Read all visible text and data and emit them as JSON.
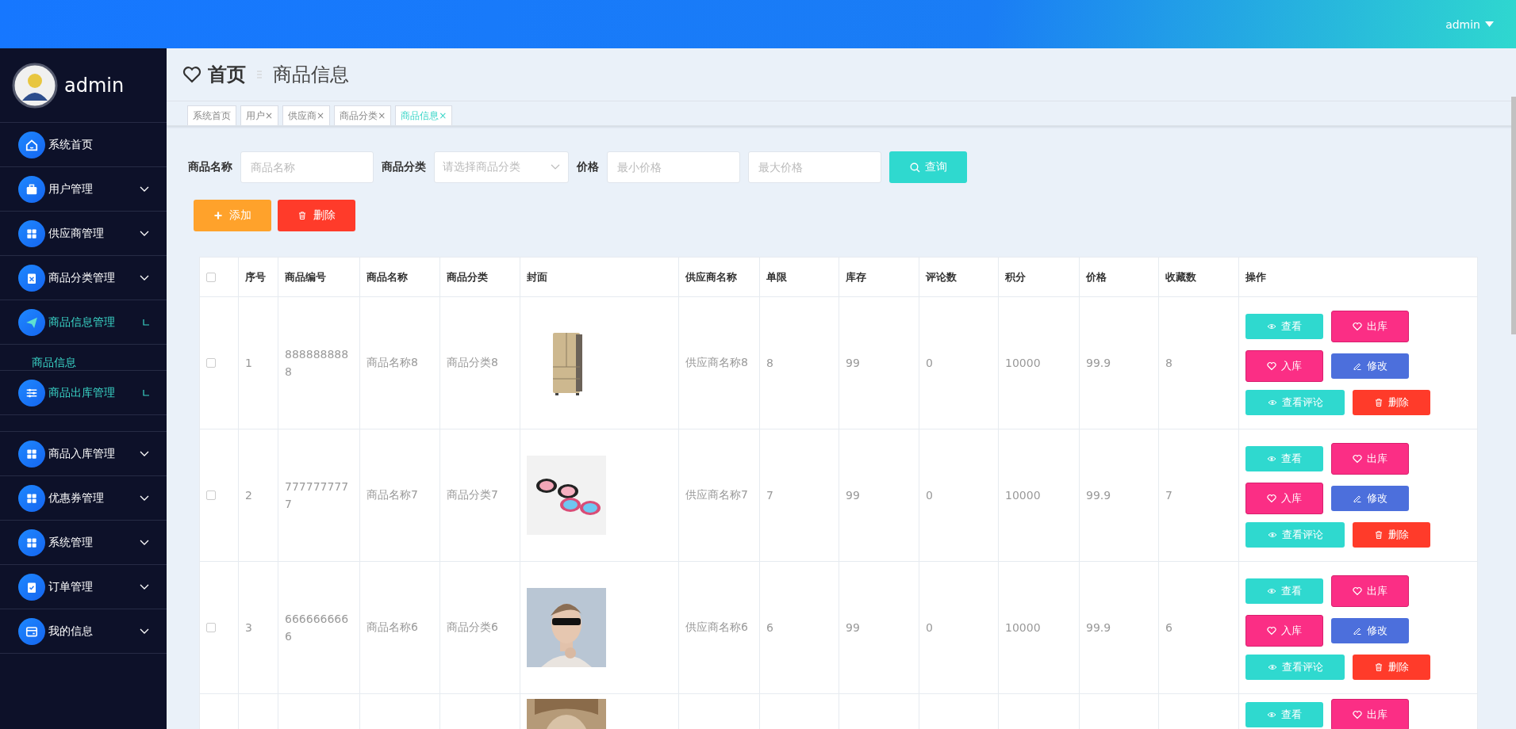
{
  "topbar": {
    "user": "admin"
  },
  "sidebar": {
    "user": "admin",
    "items": [
      {
        "label": "系统首页",
        "kind": "link"
      },
      {
        "label": "用户管理",
        "kind": "menu",
        "expanded": false
      },
      {
        "label": "供应商管理",
        "kind": "menu",
        "expanded": false
      },
      {
        "label": "商品分类管理",
        "kind": "menu",
        "expanded": false
      },
      {
        "label": "商品信息管理",
        "kind": "menu",
        "expanded": true,
        "children": [
          {
            "label": "商品信息",
            "selected": true
          }
        ]
      },
      {
        "label": "商品出库管理",
        "kind": "menu",
        "expanded": true
      },
      {
        "label": "商品入库管理",
        "kind": "menu",
        "expanded": false
      },
      {
        "label": "优惠券管理",
        "kind": "menu",
        "expanded": false
      },
      {
        "label": "系统管理",
        "kind": "menu",
        "expanded": false
      },
      {
        "label": "订单管理",
        "kind": "menu",
        "expanded": false
      },
      {
        "label": "我的信息",
        "kind": "menu",
        "expanded": false
      }
    ]
  },
  "heading": {
    "home": "首页",
    "current": "商品信息"
  },
  "tags": [
    {
      "label": "系统首页",
      "selected": false
    },
    {
      "label": "用户",
      "close": "×",
      "selected": false
    },
    {
      "label": "供应商",
      "close": "×",
      "selected": false
    },
    {
      "label": "商品分类",
      "close": "×",
      "selected": false
    },
    {
      "label": "商品信息",
      "close": "×",
      "selected": true
    }
  ],
  "search": {
    "fields": [
      {
        "label": "商品名称",
        "placeholder": "商品名称",
        "kind": "input"
      },
      {
        "label": "商品分类",
        "placeholder": "请选择商品分类",
        "kind": "select"
      },
      {
        "label": "价格",
        "placeholder": "最小价格",
        "kind": "input"
      },
      {
        "placeholder": "最大价格",
        "kind": "input"
      }
    ],
    "button": "查询"
  },
  "toolbar": [
    {
      "label": "添加",
      "kind": "add"
    },
    {
      "label": "删除",
      "kind": "delete"
    }
  ],
  "table": {
    "select_all": false,
    "columns": [
      "序号",
      "商品编号",
      "商品名称",
      "商品分类",
      "封面",
      "供应商名称",
      "单限",
      "库存",
      "评论数",
      "积分",
      "价格",
      "收藏数",
      "操作"
    ],
    "rows": [
      {
        "checked": false,
        "cells": [
          "1",
          "8888888888",
          "商品名称8",
          "商品分类8",
          null,
          "供应商名称8",
          "8",
          "99",
          "0",
          "10000",
          "99.9",
          "8"
        ],
        "cover": {
          "kind": "picture"
        },
        "actions": [
          {
            "label": "查看",
            "kind": "view"
          },
          {
            "label": "出库",
            "kind": "out"
          },
          {
            "label": "入库",
            "kind": "in"
          },
          {
            "label": "修改",
            "kind": "edit"
          },
          {
            "label": "查看评论",
            "kind": "reviews"
          },
          {
            "label": "删除",
            "kind": "delete"
          }
        ]
      },
      {
        "checked": false,
        "cells": [
          "2",
          "7777777777",
          "商品名称7",
          "商品分类7",
          null,
          "供应商名称7",
          "7",
          "99",
          "0",
          "10000",
          "99.9",
          "7"
        ],
        "cover": {
          "kind": "picture"
        },
        "actions": [
          {
            "label": "查看",
            "kind": "view"
          },
          {
            "label": "出库",
            "kind": "out"
          },
          {
            "label": "入库",
            "kind": "in"
          },
          {
            "label": "修改",
            "kind": "edit"
          },
          {
            "label": "查看评论",
            "kind": "reviews"
          },
          {
            "label": "删除",
            "kind": "delete"
          }
        ]
      },
      {
        "checked": false,
        "cells": [
          "3",
          "6666666666",
          "商品名称6",
          "商品分类6",
          null,
          "供应商名称6",
          "6",
          "99",
          "0",
          "10000",
          "99.9",
          "6"
        ],
        "cover": {
          "kind": "picture"
        },
        "actions": [
          {
            "label": "查看",
            "kind": "view"
          },
          {
            "label": "出库",
            "kind": "out"
          },
          {
            "label": "入库",
            "kind": "in"
          },
          {
            "label": "修改",
            "kind": "edit"
          },
          {
            "label": "查看评论",
            "kind": "reviews"
          },
          {
            "label": "删除",
            "kind": "delete"
          }
        ]
      },
      {
        "cover": {
          "kind": "picture"
        },
        "actions": [
          {
            "label": "查看",
            "kind": "view"
          },
          {
            "label": "出库",
            "kind": "out"
          }
        ]
      }
    ]
  }
}
